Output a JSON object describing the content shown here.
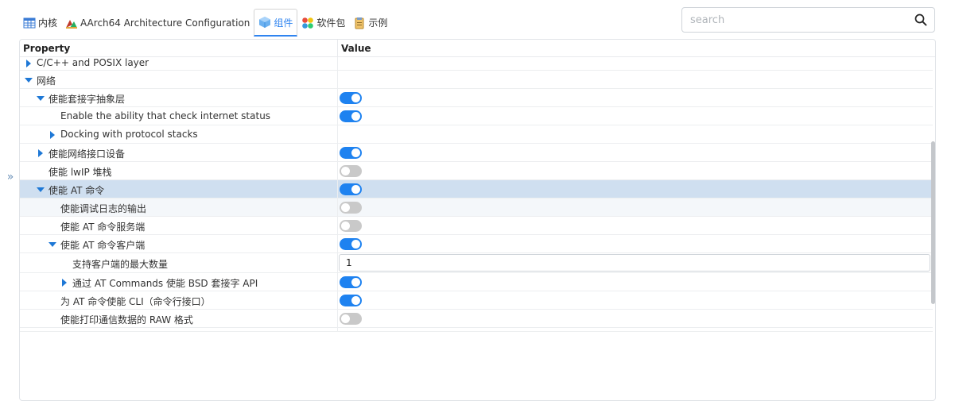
{
  "tabs": [
    {
      "label": "内核",
      "icon": "table-icon"
    },
    {
      "label": "AArch64 Architecture Configuration",
      "icon": "arch-icon"
    },
    {
      "label": "组件",
      "icon": "component-icon",
      "active": true
    },
    {
      "label": "软件包",
      "icon": "package-icon"
    },
    {
      "label": "示例",
      "icon": "example-icon"
    }
  ],
  "search": {
    "placeholder": "search"
  },
  "table": {
    "col_property": "Property",
    "col_value": "Value",
    "rows": [
      {
        "label": "C/C++ and POSIX layer",
        "expand": "right"
      },
      {
        "label": "网络",
        "expand": "down"
      },
      {
        "label": "使能套接字抽象层",
        "expand": "down",
        "value": "on"
      },
      {
        "label": "Enable the ability that check internet status",
        "value": "on"
      },
      {
        "label": "Docking with protocol stacks",
        "expand": "right"
      },
      {
        "label": "使能网络接口设备",
        "expand": "right",
        "value": "on"
      },
      {
        "label": "使能 lwIP 堆栈",
        "value": "off"
      },
      {
        "label": "使能 AT 命令",
        "expand": "down",
        "value": "on",
        "selected": true
      },
      {
        "label": "使能调试日志的输出",
        "value": "off"
      },
      {
        "label": "使能 AT 命令服务端",
        "value": "off"
      },
      {
        "label": "使能 AT 命令客户端",
        "expand": "down",
        "value": "on"
      },
      {
        "label": "支持客户端的最大数量",
        "value": "1"
      },
      {
        "label": "通过 AT Commands 使能 BSD 套接字 API",
        "expand": "right",
        "value": "on"
      },
      {
        "label": "为 AT 命令使能 CLI（命令行接口）",
        "value": "on"
      },
      {
        "label": "使能打印通信数据的 RAW 格式",
        "value": "off"
      }
    ]
  },
  "colors": {
    "accent": "#1e82f0",
    "selected_row": "#cfdff0",
    "toggle_off": "#c9c9c9"
  }
}
